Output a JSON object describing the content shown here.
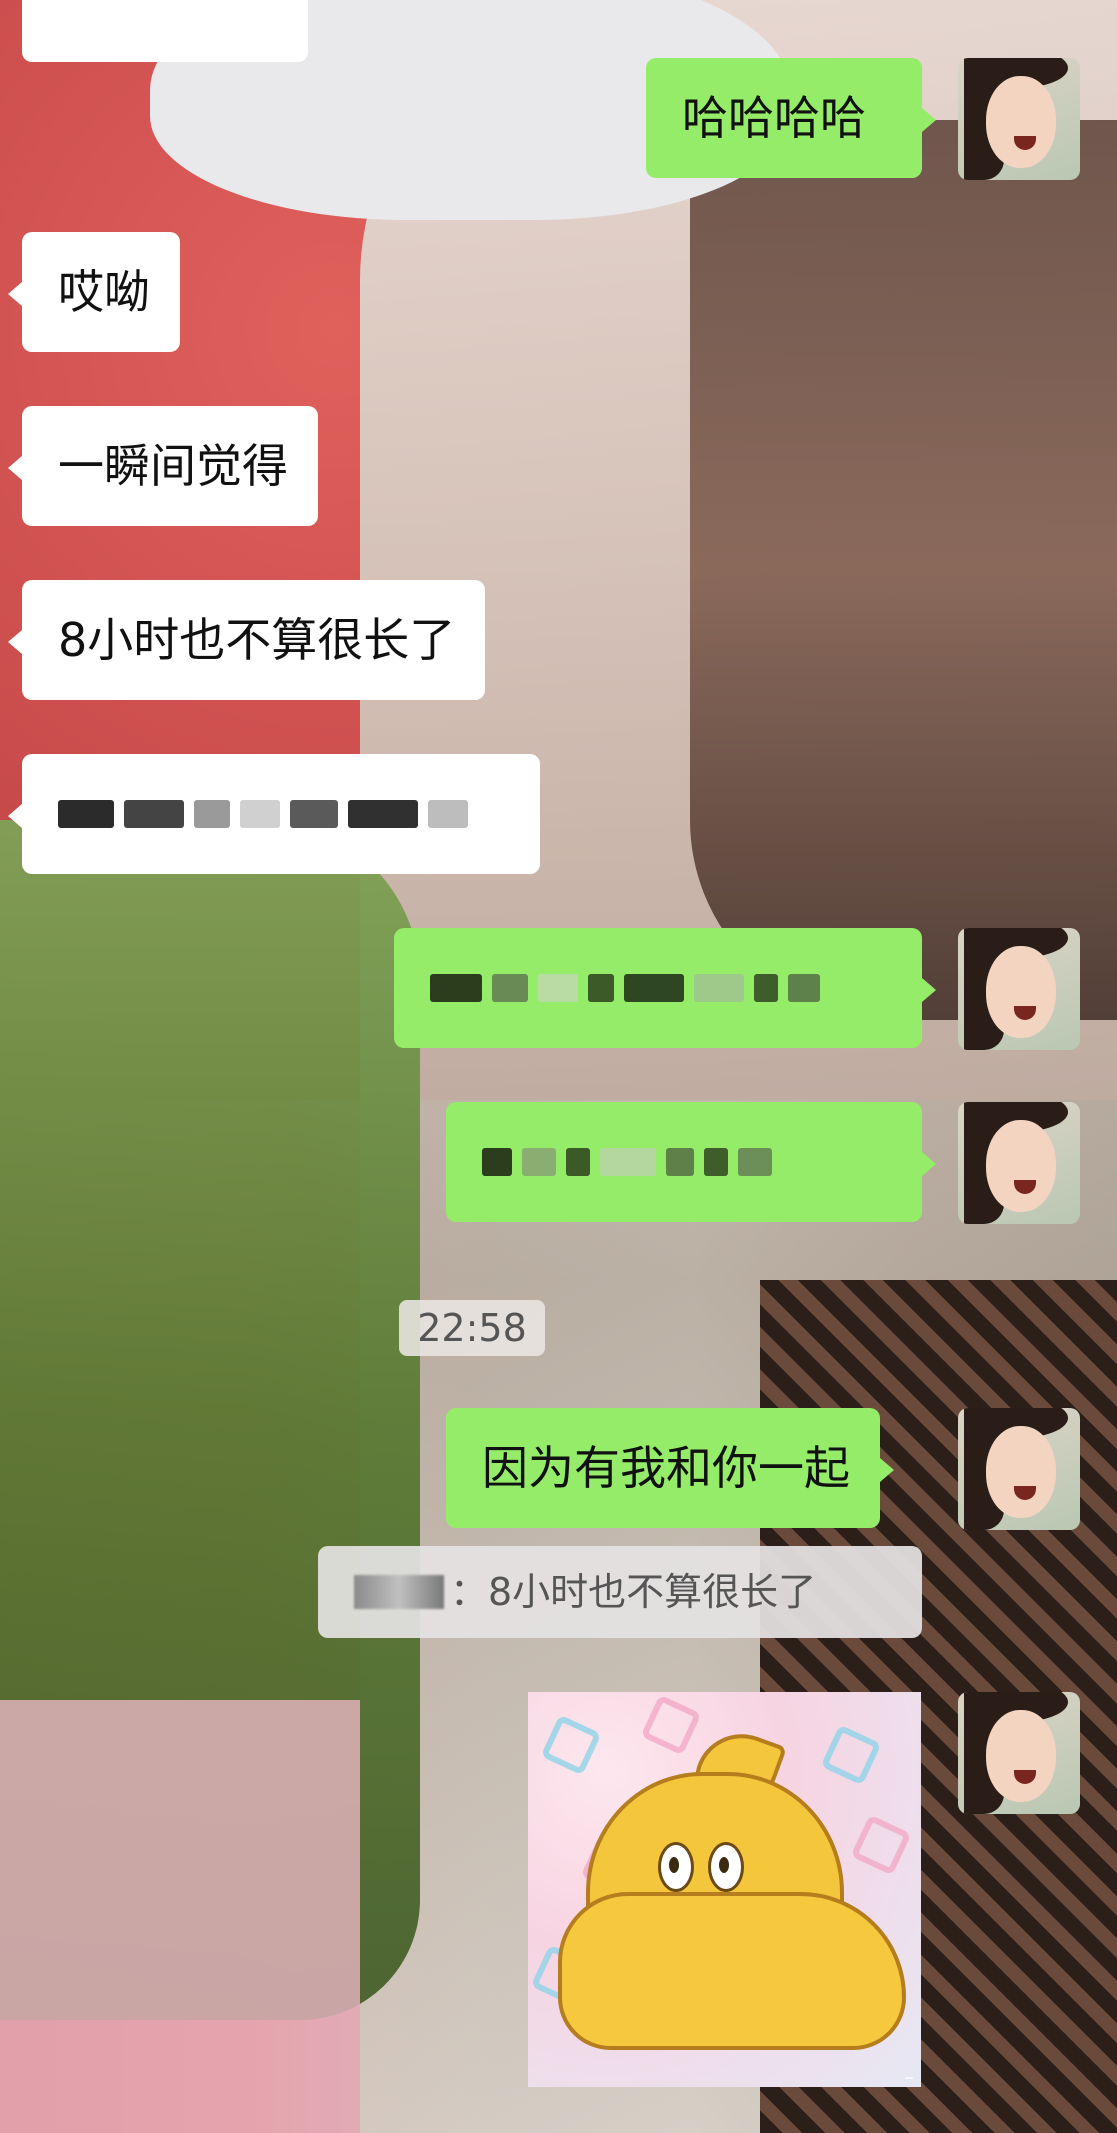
{
  "messages": {
    "m1": "哈哈哈哈",
    "m2": "哎呦",
    "m3": "一瞬间觉得",
    "m4": "8小时也不算很长了",
    "m9": "因为有我和你一起"
  },
  "timestamp": "22:58",
  "quote": {
    "text": "：8小时也不算很长了"
  },
  "colors": {
    "outgoing_bubble": "#95ec69",
    "incoming_bubble": "#ffffff",
    "timestamp_bg": "#ebe6e4"
  },
  "icons": {
    "avatar": "user-avatar",
    "sticker": "muscle-emoji-sticker"
  }
}
